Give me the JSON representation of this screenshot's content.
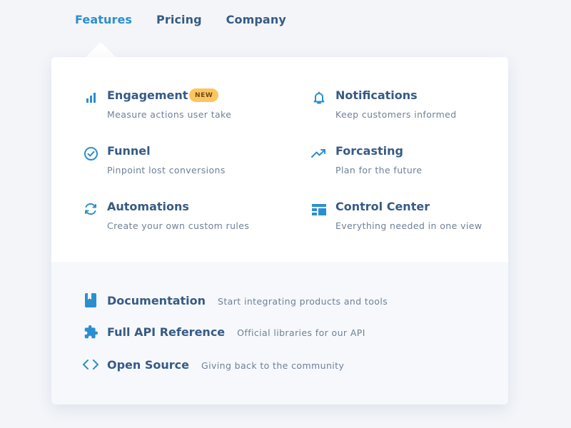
{
  "nav": {
    "items": [
      {
        "label": "Features",
        "active": true
      },
      {
        "label": "Pricing",
        "active": false
      },
      {
        "label": "Company",
        "active": false
      }
    ]
  },
  "colors": {
    "accent": "#2b8fcf",
    "heading": "#365b85",
    "muted": "#6f8197",
    "badge": "#fdc55e"
  },
  "features": [
    {
      "icon": "bar-chart-icon",
      "title": "Engagement",
      "badge": "NEW",
      "desc": "Measure actions user take"
    },
    {
      "icon": "bell-icon",
      "title": "Notifications",
      "desc": "Keep customers informed"
    },
    {
      "icon": "check-circle-icon",
      "title": "Funnel",
      "desc": "Pinpoint lost conversions"
    },
    {
      "icon": "trending-up-icon",
      "title": "Forcasting",
      "desc": "Plan for the future"
    },
    {
      "icon": "refresh-icon",
      "title": "Automations",
      "desc": "Create your own custom rules"
    },
    {
      "icon": "layout-icon",
      "title": "Control Center",
      "desc": "Everything needed in one view"
    }
  ],
  "resources": [
    {
      "icon": "book-icon",
      "title": "Documentation",
      "desc": "Start integrating products and tools"
    },
    {
      "icon": "puzzle-icon",
      "title": "Full API Reference",
      "desc": "Official libraries for our API"
    },
    {
      "icon": "code-icon",
      "title": "Open Source",
      "desc": "Giving back to the community"
    }
  ]
}
